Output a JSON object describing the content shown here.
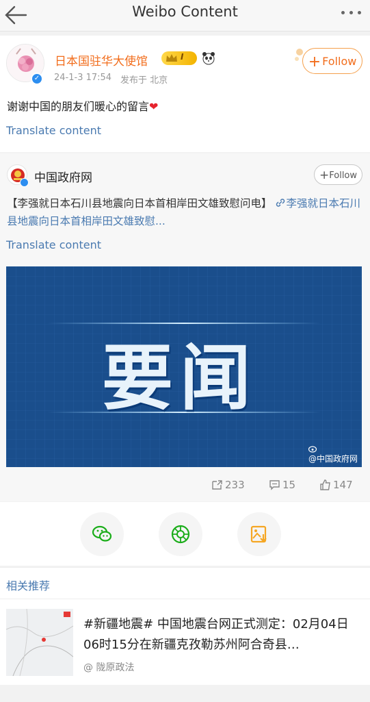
{
  "topbar": {
    "title": "Weibo Content",
    "back_icon": "arrow-left-icon",
    "more_icon": "more-dots-icon"
  },
  "post": {
    "username": "日本国驻华大使馆",
    "avatar_icon": "embassy-sakura-avatar",
    "badge_level": "I",
    "timestamp": "24-1-3 17:54",
    "source": "发布于 北京",
    "follow_label": "Follow",
    "text": "谢谢中国的朋友们暖心的留言",
    "heart": "❤",
    "translate_label": "Translate content"
  },
  "repost": {
    "author": "中国政府网",
    "follow_label": "Follow",
    "text": "【李强就日本石川县地震向日本首相岸田文雄致慰问电】",
    "link_text": "李强就日本石川县地震向日本首相岸田文雄致慰...",
    "translate_label": "Translate content",
    "image_text": "要闻",
    "image_watermark": "@中国政府网"
  },
  "stats": {
    "reposts": "233",
    "comments": "15",
    "likes": "147"
  },
  "share": {
    "items": [
      {
        "name": "wechat-share",
        "icon": "wechat-icon",
        "color": "#1aad19"
      },
      {
        "name": "moments-share",
        "icon": "moments-icon",
        "color": "#1aad19"
      },
      {
        "name": "save-image",
        "icon": "save-image-icon",
        "color": "#f5a623"
      }
    ]
  },
  "related": {
    "heading": "相关推荐",
    "title": "#新疆地震# 中国地震台网正式测定：02月04日06时15分在新疆克孜勒苏州阿合奇县…",
    "source": "@ 陇原政法"
  },
  "colors": {
    "accent_orange": "#f26d1c",
    "link_blue": "#4a7ab0",
    "news_blue": "#1a4e8c"
  }
}
